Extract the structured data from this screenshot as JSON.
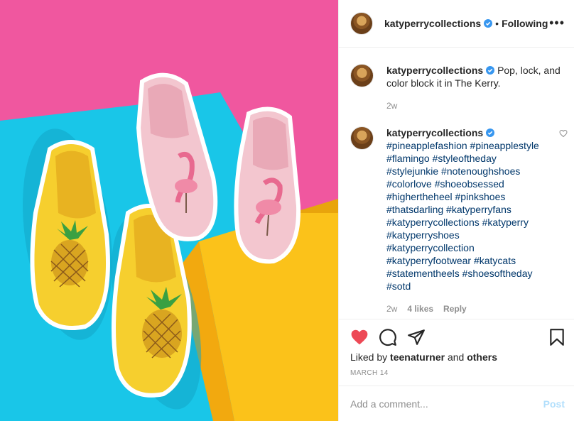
{
  "colors": {
    "pink_background": "#f0579f",
    "blue_surface": "#19c6e8",
    "yellow_block": "#fbc21a",
    "heart_red": "#ed4956",
    "verified_blue": "#3897f0",
    "link_navy": "#00376b"
  },
  "header": {
    "username": "katyperrycollections",
    "separator": "•",
    "follow_state": "Following",
    "more_label": "•••"
  },
  "caption": {
    "username": "katyperrycollections",
    "text": "Pop, lock, and color block it in The Kerry.",
    "age": "2w"
  },
  "comment": {
    "username": "katyperrycollections",
    "hashtags": [
      "#pineapplefashion #pineapplestyle",
      "#flamingo #styleoftheday",
      "#stylejunkie #notenoughshoes",
      "#colorlove #shoeobsessed",
      "#highertheheel #pinkshoes",
      "#thatsdarling #katyperryfans",
      "#katyperrycollections #katyperry",
      "#katyperryshoes",
      "#katyperrycollection",
      "#katyperryfootwear #katycats",
      "#statementheels #shoesoftheday",
      "#sotd"
    ],
    "age": "2w",
    "likes": "4 likes",
    "reply": "Reply"
  },
  "actions": {
    "like_icon": "heart-filled-icon",
    "comment_icon": "speech-bubble-icon",
    "share_icon": "paper-plane-icon",
    "save_icon": "bookmark-icon"
  },
  "likes": {
    "prefix": "Liked by",
    "user": "teenaturner",
    "conjunction": "and",
    "others": "others"
  },
  "date": "MARCH 14",
  "add_comment": {
    "placeholder": "Add a comment...",
    "post_label": "Post"
  }
}
